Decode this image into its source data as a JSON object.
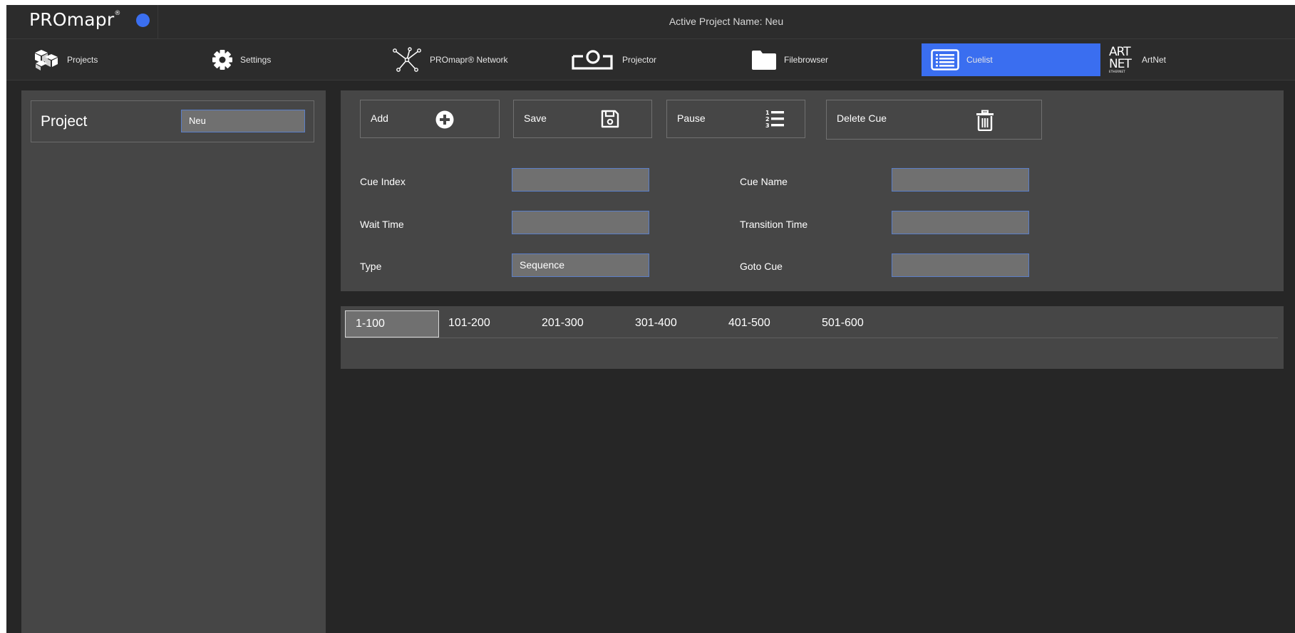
{
  "app": {
    "logo_text": "PROmapr",
    "logo_mark": "®",
    "status_color": "#3b6ff0",
    "active_project_text": "Active Project Name: Neu"
  },
  "nav": {
    "accent": "#3a6ef0",
    "items": [
      {
        "label": "Projects",
        "icon": "cubes-icon"
      },
      {
        "label": "Settings",
        "icon": "gear-icon"
      },
      {
        "label": "PROmapr® Network",
        "icon": "network-icon"
      },
      {
        "label": "Projector",
        "icon": "projector-icon"
      },
      {
        "label": "Filebrowser",
        "icon": "folder-icon"
      },
      {
        "label": "Cuelist",
        "icon": "list-icon",
        "active": true
      },
      {
        "label": "ArtNet",
        "icon": "artnet-logo-icon"
      }
    ]
  },
  "artnet_logo": {
    "line1": "ART",
    "line2": "NET",
    "line3": "ETHERNET"
  },
  "project_panel": {
    "label": "Project",
    "value": "Neu"
  },
  "toolbar": {
    "add_label": "Add",
    "save_label": "Save",
    "pause_label": "Pause",
    "delete_label": "Delete Cue"
  },
  "form": {
    "cue_index_label": "Cue Index",
    "cue_index_value": "",
    "cue_name_label": "Cue Name",
    "cue_name_value": "",
    "wait_time_label": "Wait Time",
    "wait_time_value": "",
    "transition_time_label": "Transition Time",
    "transition_time_value": "",
    "type_label": "Type",
    "type_value": "Sequence",
    "goto_cue_label": "Goto Cue",
    "goto_cue_value": ""
  },
  "ranges": [
    "1-100",
    "101-200",
    "201-300",
    "301-400",
    "401-500",
    "501-600"
  ],
  "active_range": "1-100"
}
